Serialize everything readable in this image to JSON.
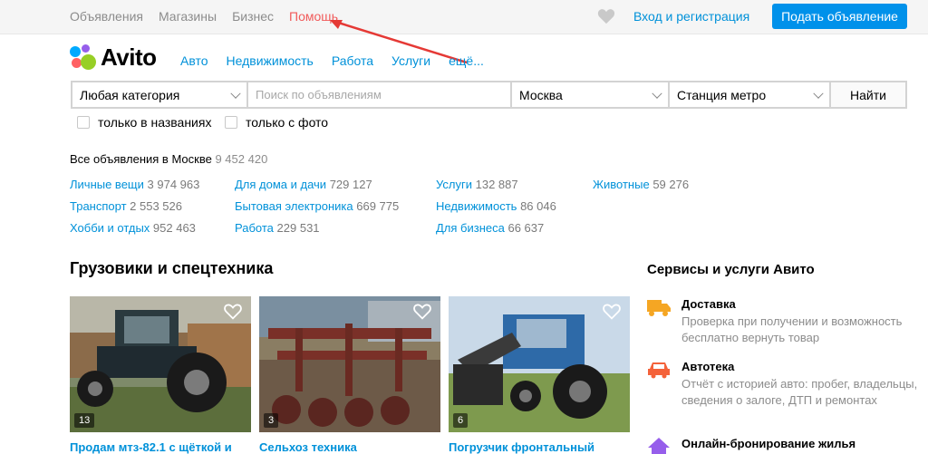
{
  "topbar": {
    "nav": [
      "Объявления",
      "Магазины",
      "Бизнес",
      "Помощь"
    ],
    "login": "Вход и регистрация",
    "post_button": "Подать объявление"
  },
  "logo": {
    "text": "Avito"
  },
  "catnav": [
    "Авто",
    "Недвижимость",
    "Работа",
    "Услуги",
    "ещё..."
  ],
  "search": {
    "category": "Любая категория",
    "placeholder": "Поиск по объявлениям",
    "city": "Москва",
    "metro": "Станция метро",
    "find": "Найти"
  },
  "filters": [
    "только в названиях",
    "только с фото"
  ],
  "all_ads": {
    "label": "Все объявления в Москве",
    "count": "9 452 420"
  },
  "categories": [
    {
      "label": "Личные вещи",
      "count": "3 974 963"
    },
    {
      "label": "Для дома и дачи",
      "count": "729 127"
    },
    {
      "label": "Услуги",
      "count": "132 887"
    },
    {
      "label": "Животные",
      "count": "59 276"
    },
    {
      "label": "Транспорт",
      "count": "2 553 526"
    },
    {
      "label": "Бытовая электроника",
      "count": "669 775"
    },
    {
      "label": "Недвижимость",
      "count": "86 046"
    },
    {
      "label": "Хобби и отдых",
      "count": "952 463"
    },
    {
      "label": "Работа",
      "count": "229 531"
    },
    {
      "label": "Для бизнеса",
      "count": "66 637"
    }
  ],
  "section": {
    "title": "Грузовики и спецтехника",
    "cards": [
      {
        "photos": "13",
        "title": "Продам мтз-82.1 с щёткой и"
      },
      {
        "photos": "3",
        "title": "Сельхоз техника"
      },
      {
        "photos": "6",
        "title": "Погрузчик фронтальный"
      }
    ]
  },
  "services": {
    "title": "Сервисы и услуги Авито",
    "items": [
      {
        "icon": "truck-icon",
        "title": "Доставка",
        "desc": "Проверка при получении и возможность бесплатно вернуть товар"
      },
      {
        "icon": "car-icon",
        "title": "Автотека",
        "desc": "Отчёт с историей авто: пробег, владельцы, сведения о залоге, ДТП и ремонтах"
      },
      {
        "icon": "house-icon",
        "title": "Онлайн-бронирование жилья",
        "desc": ""
      }
    ]
  },
  "colors": {
    "link": "#0091d9",
    "accent_button": "#0091ea",
    "help_link": "#f15b5b"
  }
}
